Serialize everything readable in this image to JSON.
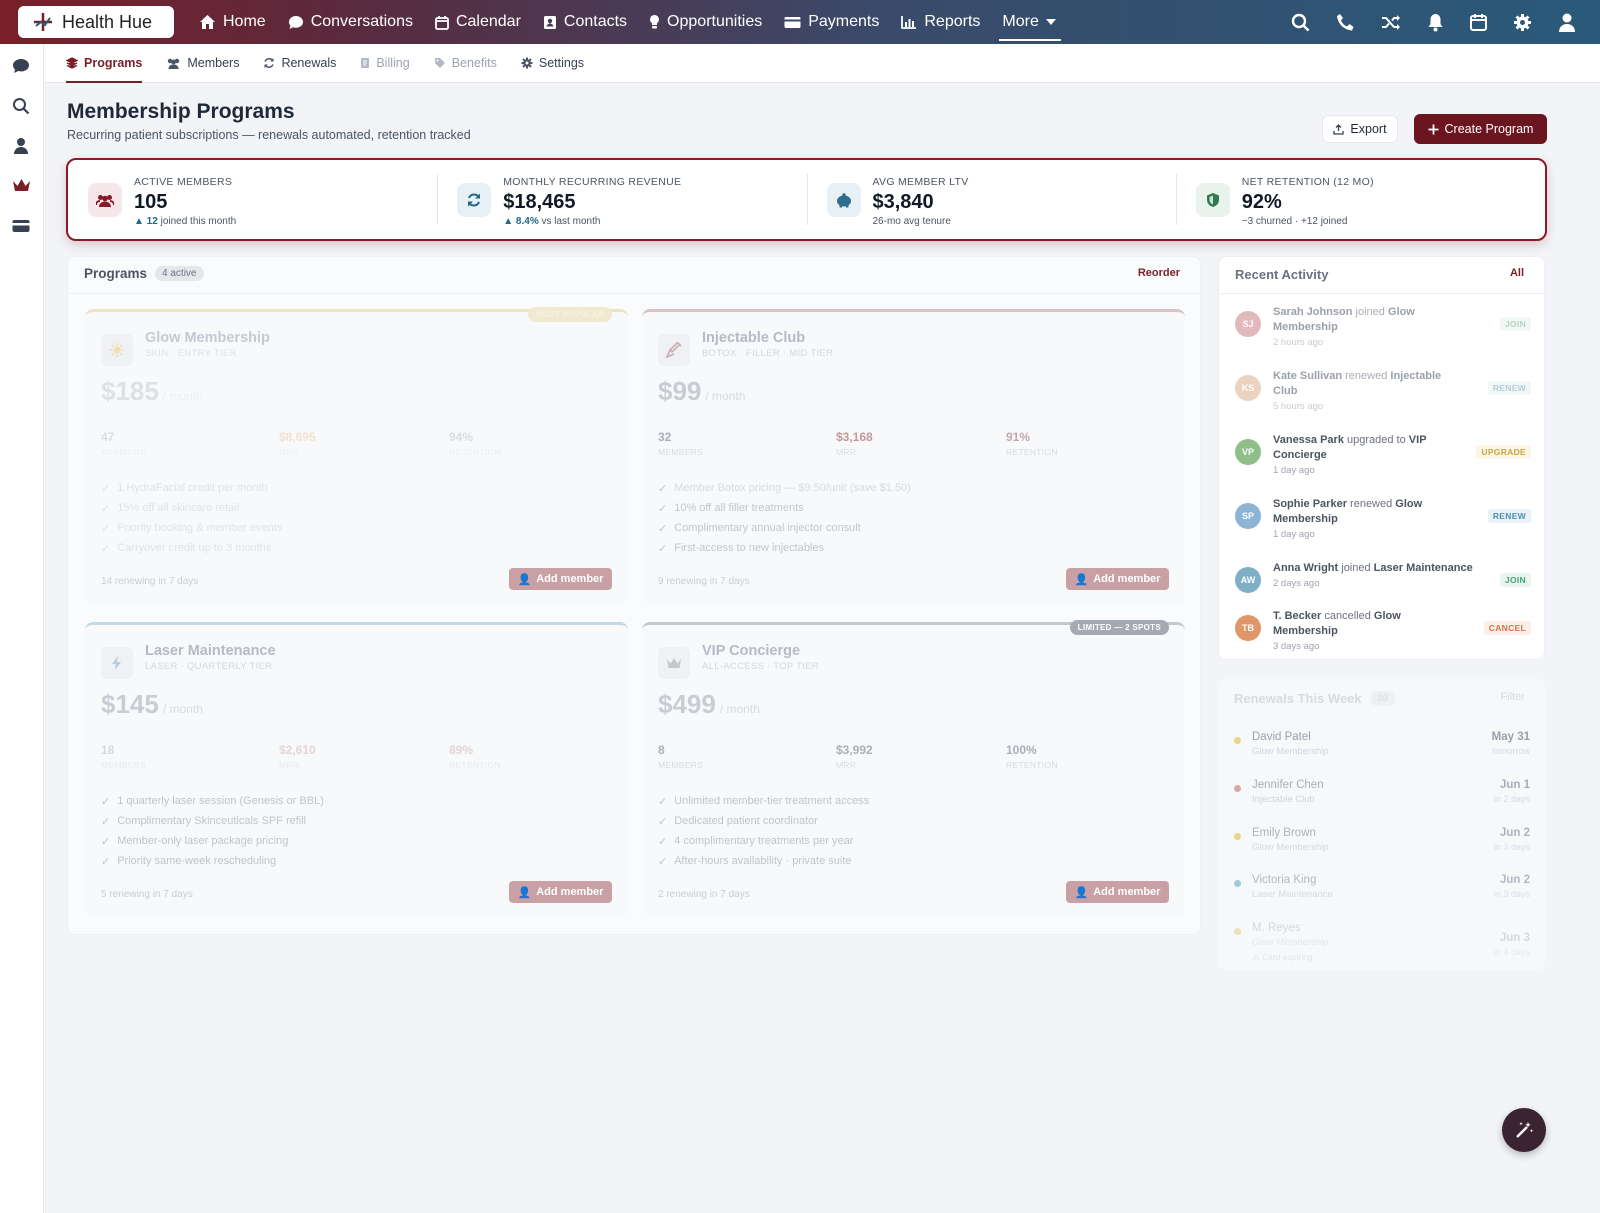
{
  "brand": {
    "name": "Health Hue"
  },
  "nav": {
    "items": [
      {
        "label": "Home",
        "icon": "home-icon"
      },
      {
        "label": "Conversations",
        "icon": "chat-icon"
      },
      {
        "label": "Calendar",
        "icon": "calendar-icon"
      },
      {
        "label": "Contacts",
        "icon": "contacts-icon"
      },
      {
        "label": "Opportunities",
        "icon": "lightbulb-icon"
      },
      {
        "label": "Payments",
        "icon": "card-icon"
      },
      {
        "label": "Reports",
        "icon": "chart-icon"
      }
    ],
    "more": "More"
  },
  "subnav": {
    "items": [
      {
        "label": "Programs",
        "state": "active"
      },
      {
        "label": "Members",
        "state": "normal"
      },
      {
        "label": "Renewals",
        "state": "normal"
      },
      {
        "label": "Billing",
        "state": "disabled"
      },
      {
        "label": "Benefits",
        "state": "disabled"
      },
      {
        "label": "Settings",
        "state": "normal"
      }
    ]
  },
  "header": {
    "title": "Membership Programs",
    "subtitle": "Recurring patient subscriptions — renewals automated, retention tracked",
    "export": "Export",
    "create": "Create Program"
  },
  "kpis": [
    {
      "label": "ACTIVE MEMBERS",
      "value": "105",
      "delta": "▲ 12",
      "delta_text": " joined this month"
    },
    {
      "label": "MONTHLY RECURRING REVENUE",
      "value": "$18,465",
      "delta": "▲ 8.4%",
      "delta_text": " vs last month"
    },
    {
      "label": "AVG MEMBER LTV",
      "value": "$3,840",
      "delta": "",
      "delta_text": "26-mo avg tenure"
    },
    {
      "label": "NET RETENTION (12 MO)",
      "value": "92%",
      "delta": "",
      "delta_text": "−3 churned · +12 joined"
    }
  ],
  "programs": {
    "title": "Programs",
    "badge": "4 active",
    "reorder": "Reorder",
    "stat_labels": [
      "MEMBERS",
      "MRR",
      "RETENTION"
    ],
    "add_label": "Add member",
    "cards": [
      {
        "name": "Glow Membership",
        "tier": "SKIN · ENTRY TIER",
        "price": "$185",
        "per": "/ month",
        "members": "47",
        "mrr": "$8,695",
        "retention": "94%",
        "features": [
          "1 HydraFacial credit per month",
          "15% off all skincare retail",
          "Priority booking & member events",
          "Carryover credit up to 3 months"
        ],
        "renewing": "14 renewing in 7 days",
        "ribbon": "MOST POPULAR",
        "accent": "#e8d8a8"
      },
      {
        "name": "Injectable Club",
        "tier": "BOTOX · FILLER · MID TIER",
        "price": "$99",
        "per": "/ month",
        "members": "32",
        "mrr": "$3,168",
        "retention": "91%",
        "features": [
          "Member Botox pricing — $9.50/unit (save $1.50)",
          "10% off all filler treatments",
          "Complimentary annual injector consult",
          "First-access to new injectables"
        ],
        "renewing": "9 renewing in 7 days",
        "ribbon": "",
        "accent": "#d9b8bb"
      },
      {
        "name": "Laser Maintenance",
        "tier": "LASER · QUARTERLY TIER",
        "price": "$145",
        "per": "/ month",
        "members": "18",
        "mrr": "$2,610",
        "retention": "89%",
        "features": [
          "1 quarterly laser session (Genesis or BBL)",
          "Complimentary Skinceuticals SPF refill",
          "Member-only laser package pricing",
          "Priority same-week rescheduling"
        ],
        "renewing": "5 renewing in 7 days",
        "ribbon": "",
        "accent": "#b9d3e0"
      },
      {
        "name": "VIP Concierge",
        "tier": "ALL-ACCESS · TOP TIER",
        "price": "$499",
        "per": "/ month",
        "members": "8",
        "mrr": "$3,992",
        "retention": "100%",
        "features": [
          "Unlimited member-tier treatment access",
          "Dedicated patient coordinator",
          "4 complimentary treatments per year",
          "After-hours availability · private suite"
        ],
        "renewing": "2 renewing in 7 days",
        "ribbon": "LIMITED — 2 SPOTS",
        "accent": "#c4c7cc"
      }
    ]
  },
  "activity": {
    "title": "Recent Activity",
    "all": "All",
    "items": [
      {
        "initials": "SJ",
        "name": "Sarah Johnson",
        "verb": " joined ",
        "program": "Glow Membership",
        "time": "2 hours ago",
        "tag": "JOIN",
        "color": "#d9a3a8",
        "tagc": "#7fb8a0",
        "tagbg": "#eef6f2"
      },
      {
        "initials": "KS",
        "name": "Kate Sullivan",
        "verb": " renewed ",
        "program": "Injectable Club",
        "time": "5 hours ago",
        "tag": "RENEW",
        "color": "#e6c2a8",
        "tagc": "#8fb7c8",
        "tagbg": "#eef5f8"
      },
      {
        "initials": "VP",
        "name": "Vanessa Park",
        "verb": " upgraded to ",
        "program": "VIP Concierge",
        "time": "1 day ago",
        "tag": "UPGRADE",
        "color": "#8fbf88",
        "tagc": "#c9a646",
        "tagbg": "#fbf5e3"
      },
      {
        "initials": "SP",
        "name": "Sophie Parker",
        "verb": " renewed ",
        "program": "Glow Membership",
        "time": "1 day ago",
        "tag": "RENEW",
        "color": "#8bb4d6",
        "tagc": "#4d8fb0",
        "tagbg": "#e8f2f7"
      },
      {
        "initials": "AW",
        "name": "Anna Wright",
        "verb": " joined ",
        "program": "Laser Maintenance",
        "time": "2 days ago",
        "tag": "JOIN",
        "color": "#7fb0c6",
        "tagc": "#4aa07c",
        "tagbg": "#e9f5ef"
      },
      {
        "initials": "TB",
        "name": "T. Becker",
        "verb": " cancelled ",
        "program": "Glow Membership",
        "time": "3 days ago",
        "tag": "CANCEL",
        "color": "#e0966a",
        "tagc": "#d2744a",
        "tagbg": "#fbefe7"
      }
    ]
  },
  "renewals": {
    "title": "Renewals This Week",
    "badge": "30",
    "filter": "Filter",
    "items": [
      {
        "name": "David Patel",
        "program": "Glow Membership",
        "date": "May 31",
        "when": "tomorrow",
        "dot": "#e9d58a",
        "fade": "#9aa1ab"
      },
      {
        "name": "Jennifer Chen",
        "program": "Injectable Club",
        "date": "Jun 1",
        "when": "in 2 days",
        "dot": "#d8a8ad",
        "fade": "#a7adb6"
      },
      {
        "name": "Emily Brown",
        "program": "Glow Membership",
        "date": "Jun 2",
        "when": "in 3 days",
        "dot": "#e9d58a",
        "fade": "#adb3bb"
      },
      {
        "name": "Victoria King",
        "program": "Laser Maintenance",
        "date": "Jun 2",
        "when": "in 3 days",
        "dot": "#9ccbd8",
        "fade": "#b3b9c1"
      },
      {
        "name": "M. Reyes",
        "program": "Glow Membership",
        "date": "Jun 3",
        "when": "in 4 days",
        "dot": "#e9e2b8",
        "fade": "#d4d8de",
        "note": "⚠ Card expiring"
      }
    ]
  }
}
